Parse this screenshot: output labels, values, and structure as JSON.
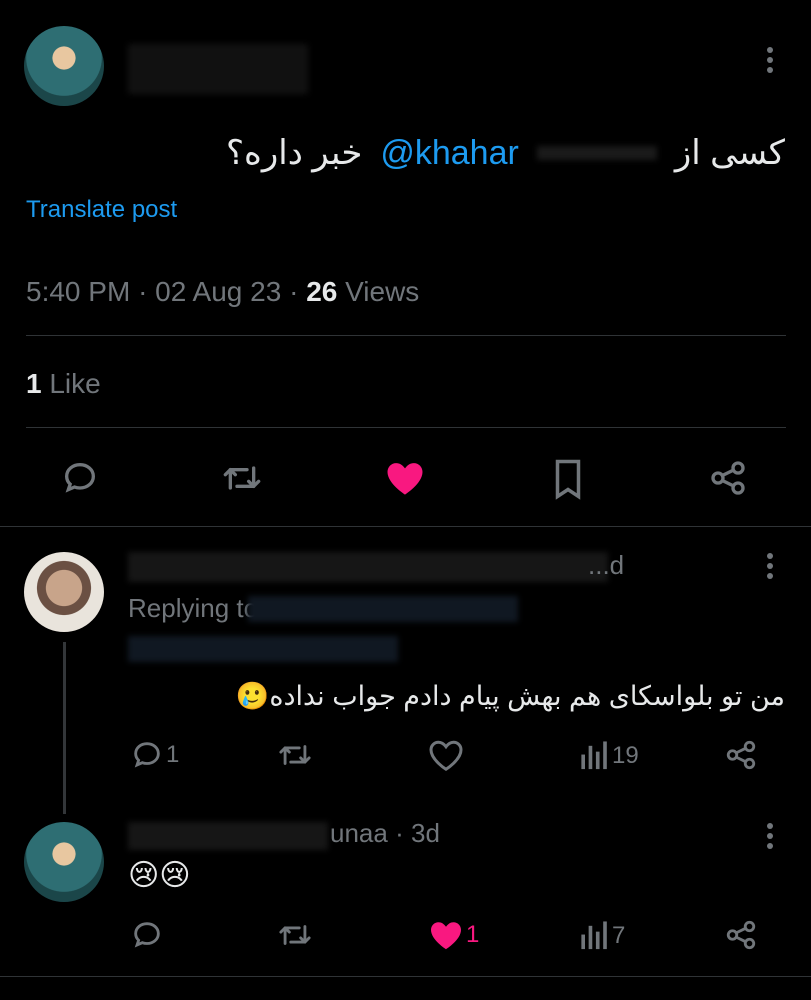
{
  "main_post": {
    "author_name": "",
    "text_rtl_prefix": "کسی از",
    "mention": "@khahar",
    "text_rtl_suffix": "خبر داره؟",
    "translate_label": "Translate post",
    "time": "5:40 PM",
    "date": "02 Aug 23",
    "views_count": "26",
    "views_label": "Views",
    "likes_count": "1",
    "likes_label": "Like",
    "colors": {
      "liked": "#f91880",
      "link": "#1d9bf0"
    }
  },
  "reply1": {
    "header_fragment": "...d",
    "replying_prefix": "Replying to",
    "text": "من تو بلواسکای هم بهش پیام دادم جواب نداده🥲",
    "reply_count": "1",
    "views_count": "19"
  },
  "reply2": {
    "handle_fragment": "unaa",
    "time": "3d",
    "text": "😢😢",
    "like_count": "1",
    "views_count": "7"
  },
  "icons": {
    "reply": "reply-icon",
    "repost": "repost-icon",
    "like": "heart-icon",
    "bookmark": "bookmark-icon",
    "share": "share-icon",
    "views": "views-icon",
    "more": "more-icon"
  }
}
